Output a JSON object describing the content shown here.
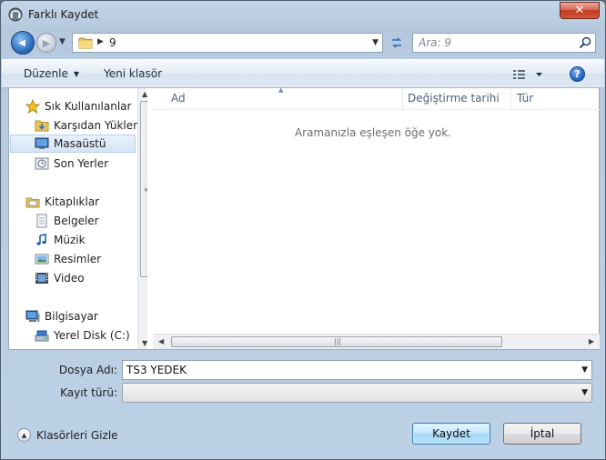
{
  "window": {
    "title": "Farklı Kaydet",
    "close_glyph": "✕"
  },
  "navigation": {
    "back_glyph": "◀",
    "forward_glyph": "▶",
    "breadcrumb": [
      "9"
    ],
    "search_placeholder": "Ara: 9"
  },
  "toolbar": {
    "organize_label": "Düzenle",
    "new_folder_label": "Yeni klasör",
    "help_glyph": "?"
  },
  "nav_pane": {
    "items": [
      {
        "label": "Sık Kullanılanlar",
        "icon": "star-icon",
        "level": 0
      },
      {
        "label": "Karşıdan Yüklemeler",
        "icon": "download-folder-icon",
        "level": 1
      },
      {
        "label": "Masaüstü",
        "icon": "desktop-icon",
        "level": 1,
        "selected": true
      },
      {
        "label": "Son Yerler",
        "icon": "recent-places-icon",
        "level": 1
      },
      {
        "label": "Kitaplıklar",
        "icon": "libraries-icon",
        "level": 0
      },
      {
        "label": "Belgeler",
        "icon": "documents-icon",
        "level": 1
      },
      {
        "label": "Müzik",
        "icon": "music-icon",
        "level": 1
      },
      {
        "label": "Resimler",
        "icon": "pictures-icon",
        "level": 1
      },
      {
        "label": "Video",
        "icon": "video-icon",
        "level": 1
      },
      {
        "label": "Bilgisayar",
        "icon": "computer-icon",
        "level": 0
      },
      {
        "label": "Yerel Disk (C:)",
        "icon": "disk-icon",
        "level": 1
      }
    ]
  },
  "file_list": {
    "columns": [
      "Ad",
      "Değiştirme tarihi",
      "Tür"
    ],
    "empty_message": "Aramanızla eşleşen öğe yok."
  },
  "form": {
    "filename_label": "Dosya Adı:",
    "filename_value": "TS3 YEDEK",
    "type_label": "Kayıt türü:",
    "type_value": ""
  },
  "footer": {
    "hide_folders_label": "Klasörleri Gizle",
    "save_label": "Kaydet",
    "cancel_label": "İptal"
  },
  "colors": {
    "window_frame": "#bcd0e6",
    "selection": "#d5e4f5",
    "close_button": "#c2391f",
    "save_button_border": "#3c7fb1"
  }
}
